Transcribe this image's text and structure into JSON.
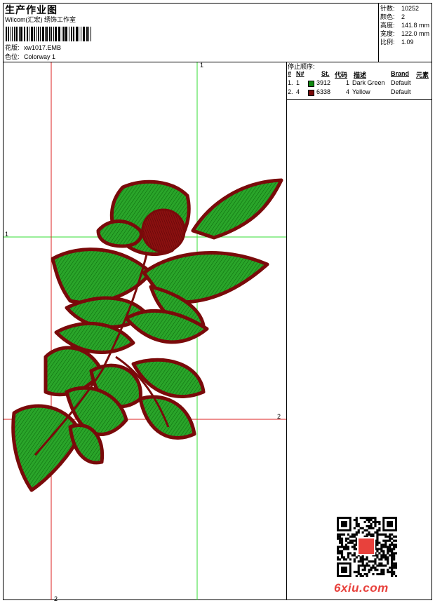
{
  "header": {
    "title": "生产作业图",
    "company": "Wilcom(汇宏) 绣饰工作室",
    "design_label": "花版:",
    "design_value": "xw1017.EMB",
    "color_label": "色位:",
    "color_value": "Colorway 1"
  },
  "stats": [
    {
      "label": "针数:",
      "value": "10252"
    },
    {
      "label": "颜色:",
      "value": "2"
    },
    {
      "label": "高度:",
      "value": "141.8 mm"
    },
    {
      "label": "宽度:",
      "value": "122.0 mm"
    },
    {
      "label": "比例:",
      "value": "1.09"
    }
  ],
  "stop_sequence": {
    "title": "停止顺序:",
    "columns": [
      "#",
      "N#",
      "St.",
      "代码",
      "描述",
      "Brand",
      "元素"
    ],
    "rows": [
      {
        "index": "1.",
        "needle": "1",
        "code": "3912",
        "st": "1",
        "desc": "Dark Green",
        "brand": "Default",
        "color": "#118a11"
      },
      {
        "index": "2.",
        "needle": "4",
        "code": "6338",
        "st": "4",
        "desc": "Yellow",
        "brand": "Default",
        "color": "#7a0a0a"
      }
    ]
  },
  "guides": {
    "top": "1",
    "left": "1",
    "right": "2",
    "bottom": "2"
  },
  "watermark": "6xiu.com",
  "colors": {
    "thread_green": "#118a11",
    "thread_red": "#7a0a0a",
    "guide_green": "#33dd33",
    "guide_red": "#dd2222"
  }
}
